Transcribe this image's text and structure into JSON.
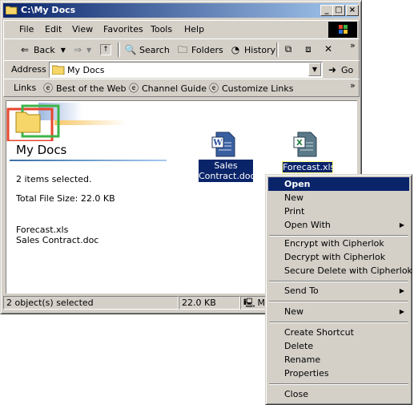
{
  "window": {
    "title": "C:\\My Docs",
    "minimize_glyph": "_",
    "maximize_glyph": "□",
    "close_glyph": "×"
  },
  "menubar": [
    "File",
    "Edit",
    "View",
    "Favorites",
    "Tools",
    "Help"
  ],
  "toolbar": {
    "back": "Back",
    "search": "Search",
    "folders": "Folders",
    "history": "History",
    "chevron": "»"
  },
  "address": {
    "label": "Address",
    "value": "My Docs",
    "go": "Go"
  },
  "links": {
    "label": "Links",
    "items": [
      "Best of the Web",
      "Channel Guide",
      "Customize Links"
    ]
  },
  "folder_panel": {
    "title": "My Docs",
    "selection": "2 items selected.",
    "total_size": "Total File Size: 22.0 KB",
    "files": [
      "Forecast.xls",
      "Sales Contract.doc"
    ]
  },
  "files": [
    {
      "name_line1": "Sales",
      "name_line2": "Contract.doc",
      "icon": "word-document-icon"
    },
    {
      "name": "Forecast.xls",
      "icon": "excel-document-icon"
    }
  ],
  "status": {
    "objects": "2 object(s) selected",
    "size": "22.0 KB",
    "zone": "M"
  },
  "context_menu": {
    "items": [
      {
        "label": "Open",
        "selected": true
      },
      {
        "label": "New"
      },
      {
        "label": "Print"
      },
      {
        "label": "Open With",
        "submenu": true
      },
      {
        "label": "Encrypt with Cipherlok"
      },
      {
        "label": "Decrypt with Cipherlok"
      },
      {
        "label": "Secure Delete with Cipherlok"
      },
      {
        "label": "Send To",
        "submenu": true
      },
      {
        "label": "New",
        "submenu": true
      },
      {
        "label": "Create Shortcut"
      },
      {
        "label": "Delete"
      },
      {
        "label": "Rename"
      },
      {
        "label": "Properties"
      },
      {
        "label": "Close"
      }
    ]
  },
  "colors": {
    "title_active": "#0a246a",
    "selection": "#0a246a",
    "face": "#d4d0c8"
  }
}
